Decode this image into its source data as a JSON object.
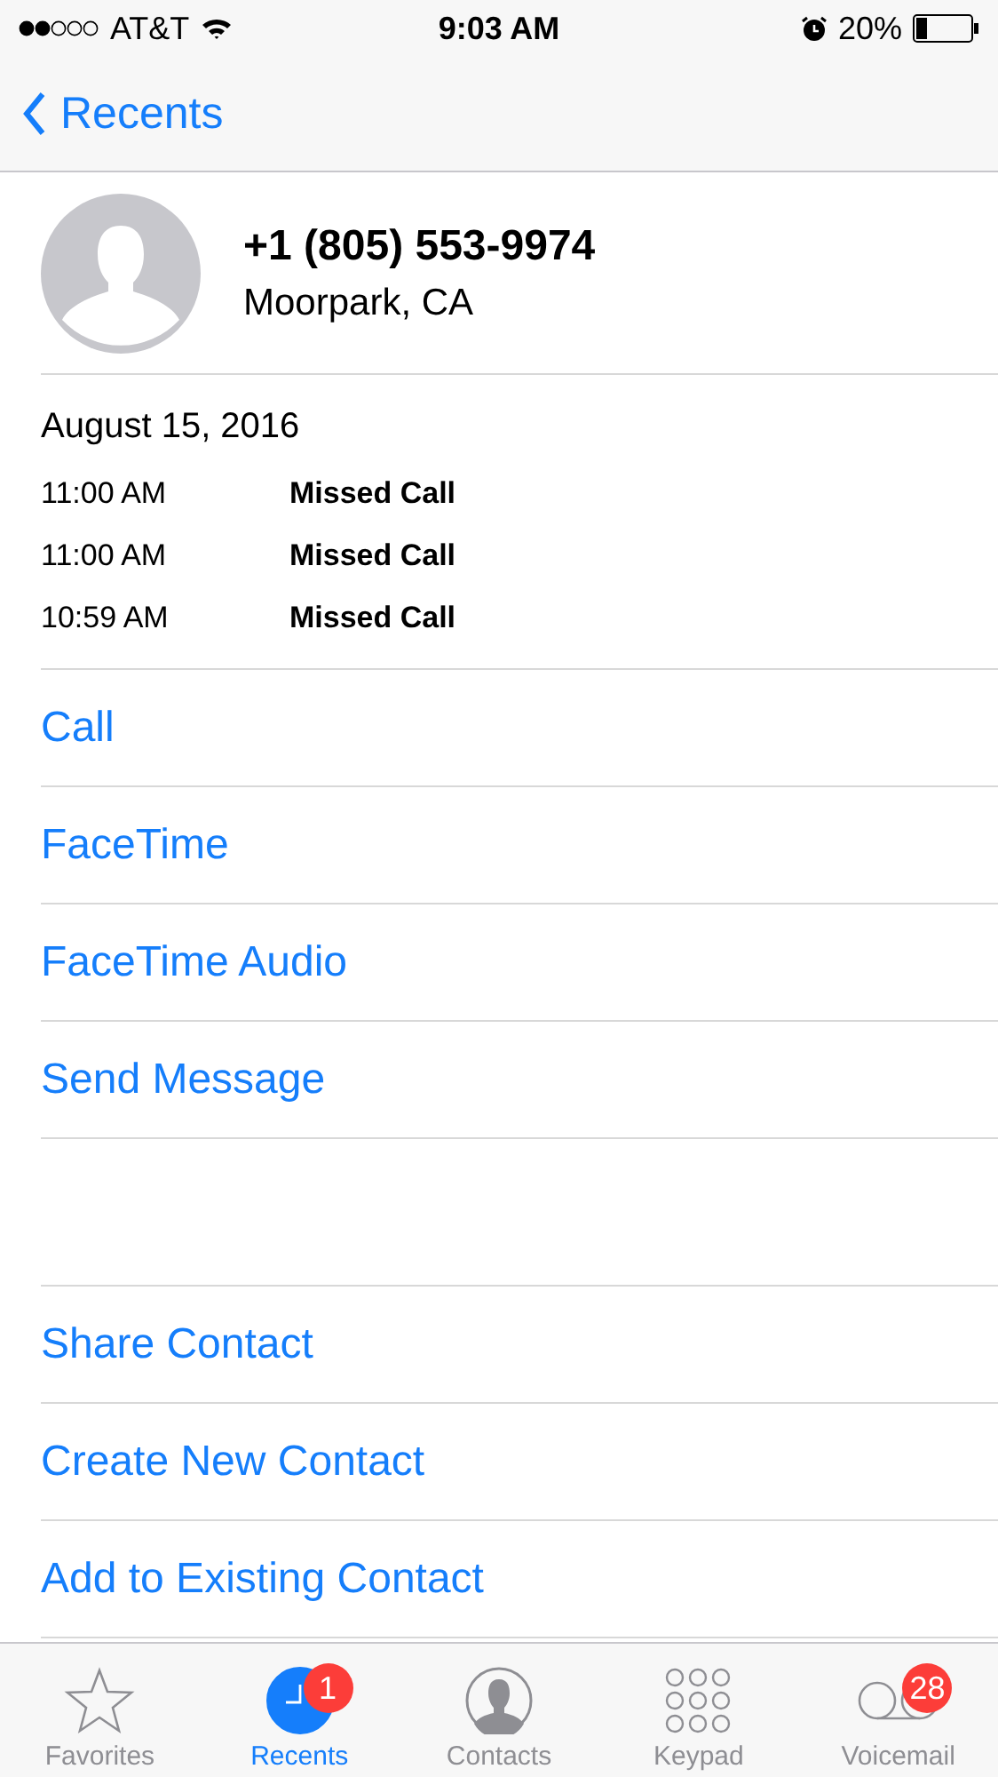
{
  "status_bar": {
    "carrier": "AT&T",
    "time": "9:03 AM",
    "battery": "20%"
  },
  "nav": {
    "back": "Recents"
  },
  "contact": {
    "number": "+1 (805) 553-9974",
    "location": "Moorpark, CA"
  },
  "calls": {
    "date": "August 15, 2016",
    "entries": [
      {
        "time": "11:00 AM",
        "type": "Missed Call"
      },
      {
        "time": "11:00 AM",
        "type": "Missed Call"
      },
      {
        "time": "10:59 AM",
        "type": "Missed Call"
      }
    ]
  },
  "actions": [
    "Call",
    "FaceTime",
    "FaceTime Audio",
    "Send Message"
  ],
  "contact_actions": [
    "Share Contact",
    "Create New Contact",
    "Add to Existing Contact"
  ],
  "tabs": [
    {
      "kind": "star",
      "label": "Favorites",
      "selected": false
    },
    {
      "kind": "clock",
      "label": "Recents",
      "selected": true,
      "badge": "1"
    },
    {
      "kind": "person",
      "label": "Contacts",
      "selected": false
    },
    {
      "kind": "keypad",
      "label": "Keypad",
      "selected": false
    },
    {
      "kind": "voicemail",
      "label": "Voicemail",
      "selected": false,
      "badge": "28"
    }
  ]
}
